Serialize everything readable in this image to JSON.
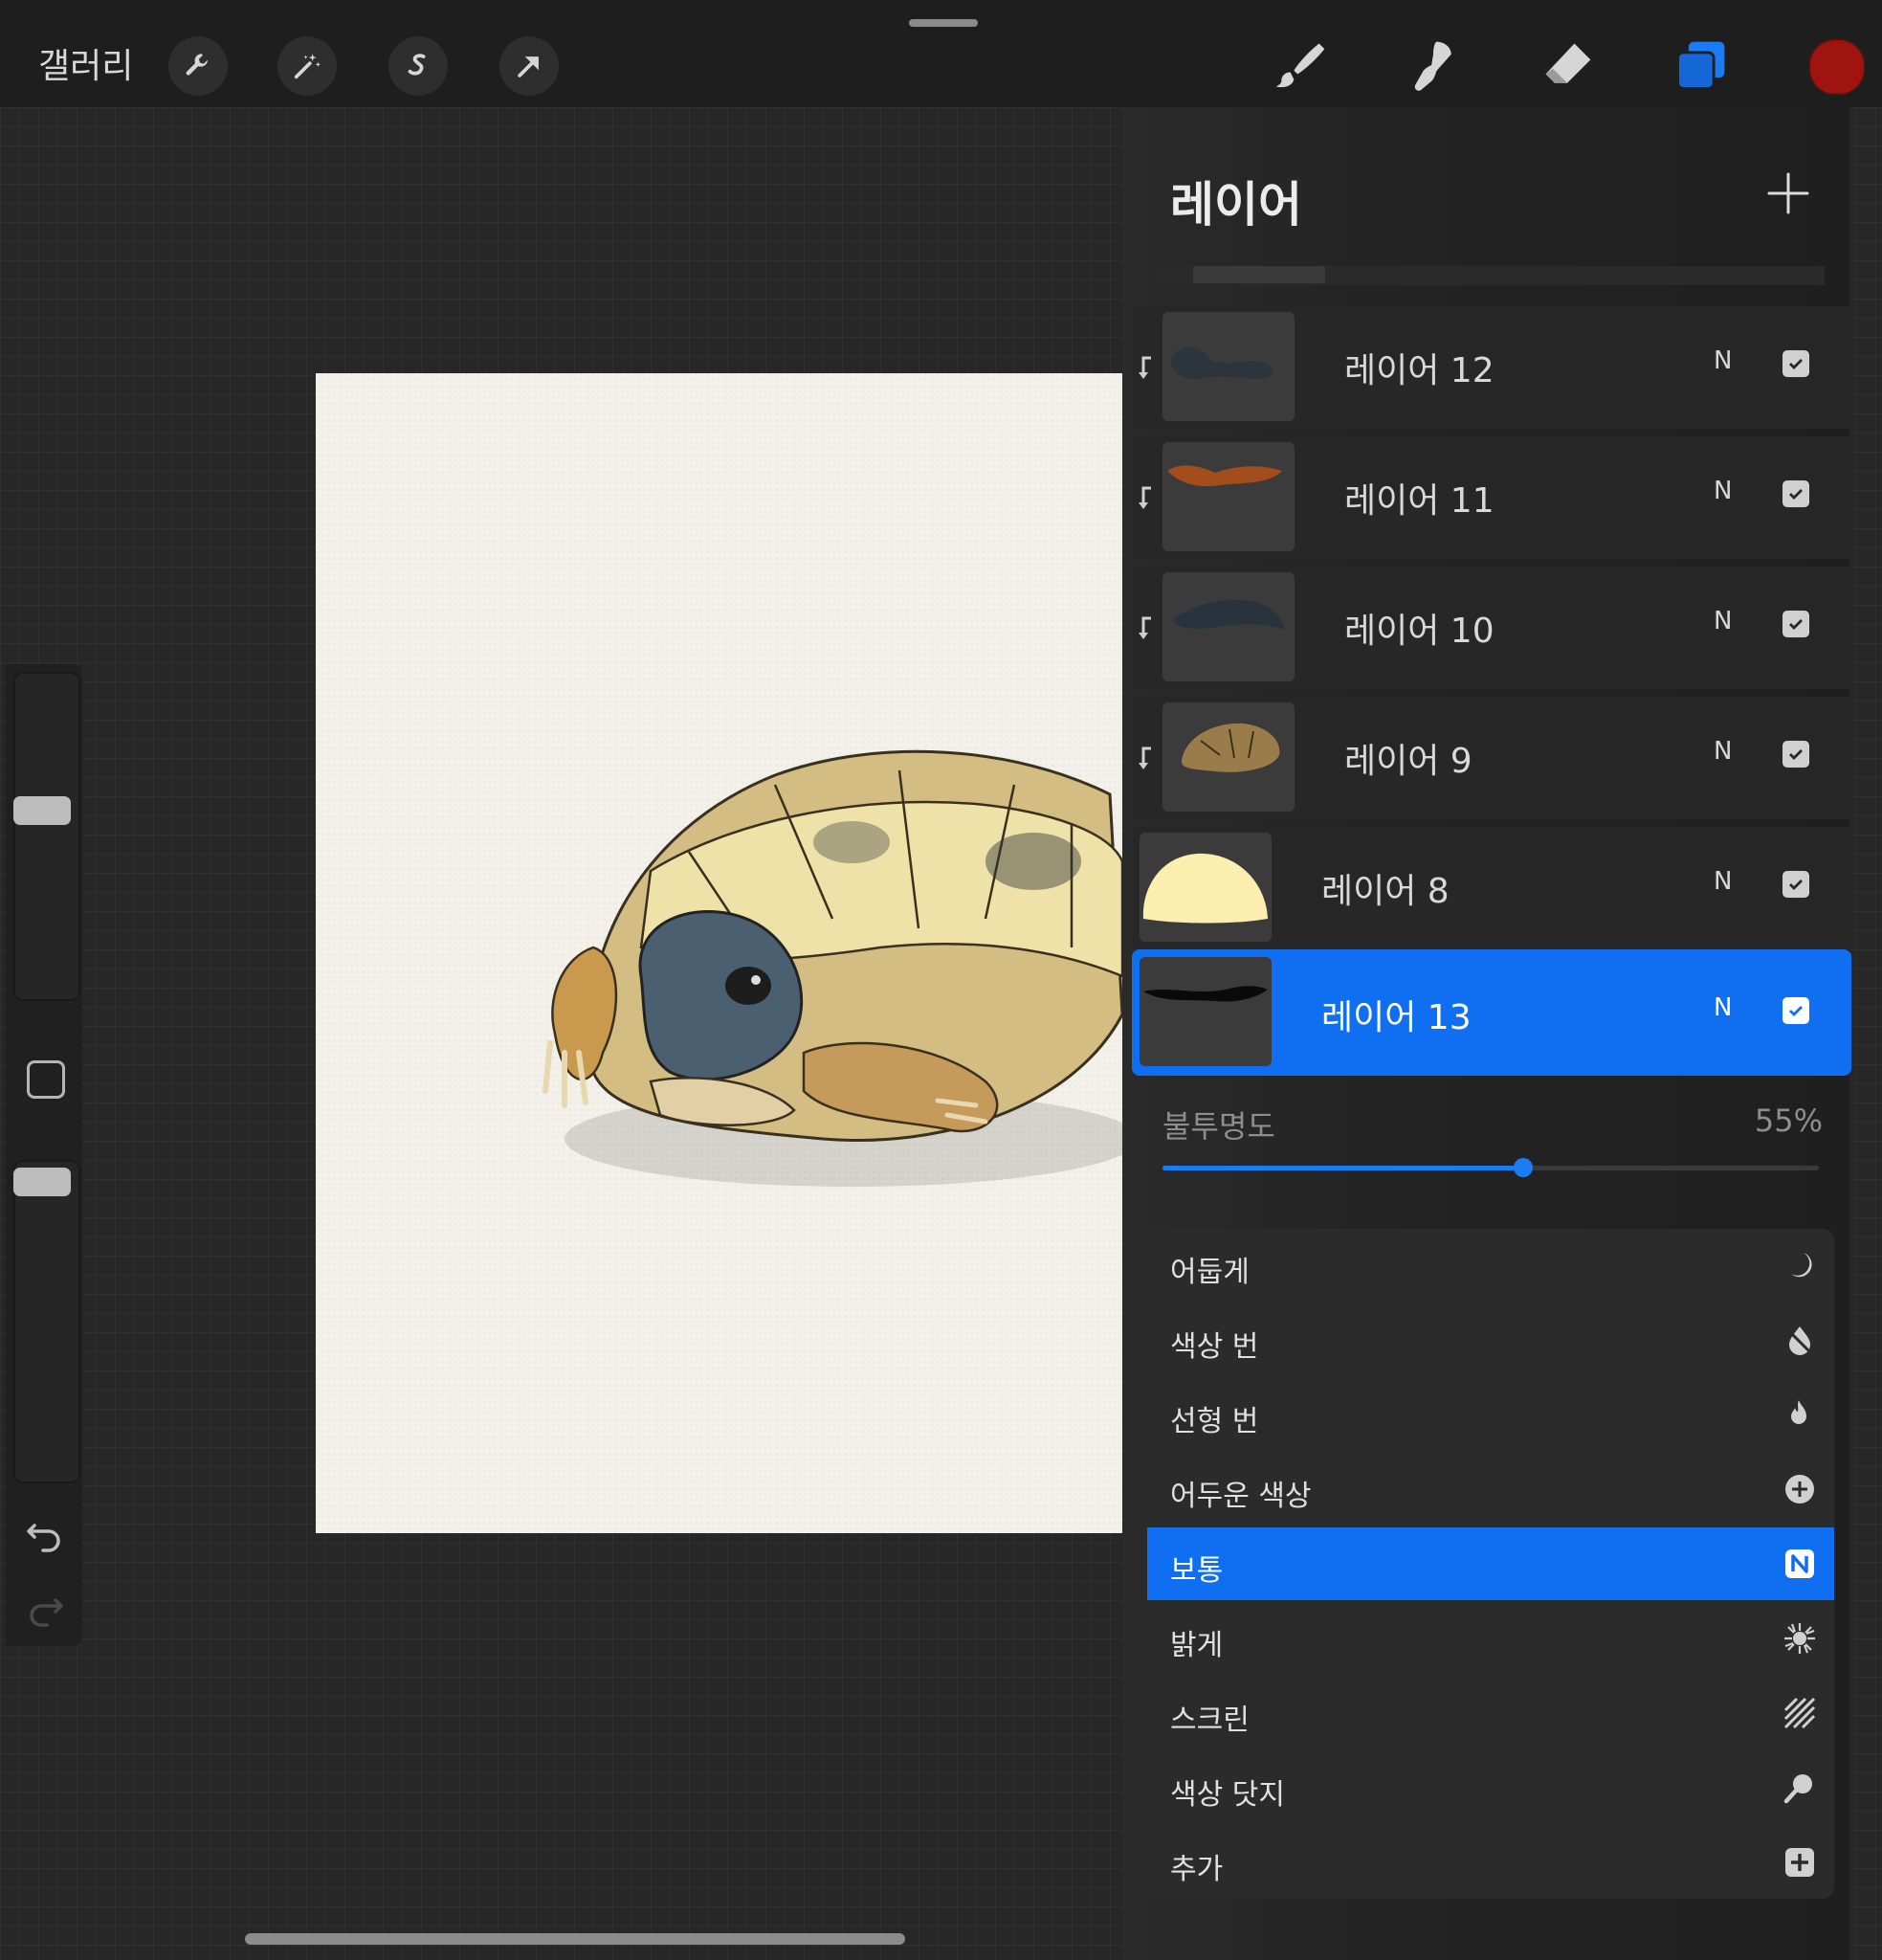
{
  "topbar": {
    "gallery_label": "갤러리",
    "left_tools": [
      "wrench-icon",
      "magic-wand-icon",
      "selection-icon",
      "transform-arrow-icon"
    ],
    "right_tools": [
      "brush-icon",
      "smudge-icon",
      "eraser-icon",
      "layers-icon"
    ],
    "active_color": "#a0140f"
  },
  "layers_panel": {
    "title": "레이어",
    "layers": [
      {
        "name": "레이어 12",
        "blend": "N",
        "visible": true,
        "clipped": true,
        "selected": false
      },
      {
        "name": "레이어 11",
        "blend": "N",
        "visible": true,
        "clipped": true,
        "selected": false
      },
      {
        "name": "레이어 10",
        "blend": "N",
        "visible": true,
        "clipped": true,
        "selected": false
      },
      {
        "name": "레이어 9",
        "blend": "N",
        "visible": true,
        "clipped": true,
        "selected": false
      },
      {
        "name": "레이어 8",
        "blend": "N",
        "visible": true,
        "clipped": false,
        "selected": false
      },
      {
        "name": "레이어 13",
        "blend": "N",
        "visible": true,
        "clipped": false,
        "selected": true
      }
    ],
    "opacity_label": "불투명도",
    "opacity_value": "55%",
    "opacity_fraction": 0.55
  },
  "blend_modes": {
    "items": [
      {
        "label": "어둡게",
        "icon": "moon-icon",
        "active": false
      },
      {
        "label": "색상 번",
        "icon": "burn-drop-icon",
        "active": false
      },
      {
        "label": "선형 번",
        "icon": "flame-icon",
        "active": false
      },
      {
        "label": "어두운 색상",
        "icon": "plus-circle-icon",
        "active": false
      },
      {
        "label": "보통",
        "icon": "n-badge-icon",
        "active": true
      },
      {
        "label": "밝게",
        "icon": "sunburst-icon",
        "active": false
      },
      {
        "label": "스크린",
        "icon": "hatch-icon",
        "active": false
      },
      {
        "label": "색상 닷지",
        "icon": "magnifier-icon",
        "active": false
      },
      {
        "label": "추가",
        "icon": "plus-square-icon",
        "active": false
      }
    ],
    "active_badge": "N"
  },
  "colors": {
    "accent": "#0f6ff0",
    "panel": "#232323",
    "canvas_paper": "#f3f1e9"
  }
}
